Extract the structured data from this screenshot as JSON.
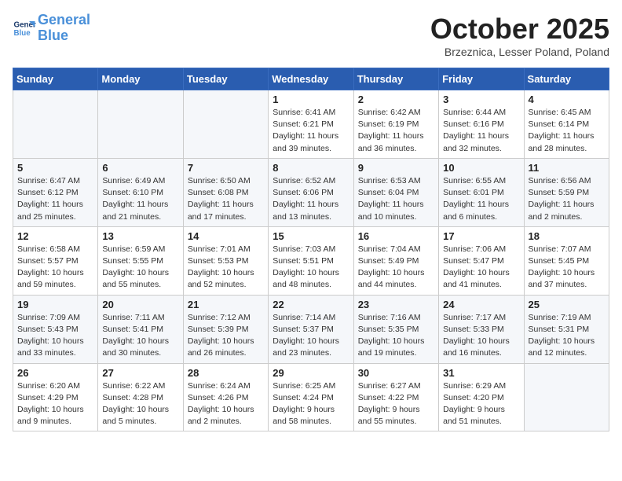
{
  "logo": {
    "line1": "General",
    "line2": "Blue"
  },
  "title": "October 2025",
  "location": "Brzeznica, Lesser Poland, Poland",
  "weekdays": [
    "Sunday",
    "Monday",
    "Tuesday",
    "Wednesday",
    "Thursday",
    "Friday",
    "Saturday"
  ],
  "weeks": [
    [
      {
        "day": "",
        "info": ""
      },
      {
        "day": "",
        "info": ""
      },
      {
        "day": "",
        "info": ""
      },
      {
        "day": "1",
        "info": "Sunrise: 6:41 AM\nSunset: 6:21 PM\nDaylight: 11 hours\nand 39 minutes."
      },
      {
        "day": "2",
        "info": "Sunrise: 6:42 AM\nSunset: 6:19 PM\nDaylight: 11 hours\nand 36 minutes."
      },
      {
        "day": "3",
        "info": "Sunrise: 6:44 AM\nSunset: 6:16 PM\nDaylight: 11 hours\nand 32 minutes."
      },
      {
        "day": "4",
        "info": "Sunrise: 6:45 AM\nSunset: 6:14 PM\nDaylight: 11 hours\nand 28 minutes."
      }
    ],
    [
      {
        "day": "5",
        "info": "Sunrise: 6:47 AM\nSunset: 6:12 PM\nDaylight: 11 hours\nand 25 minutes."
      },
      {
        "day": "6",
        "info": "Sunrise: 6:49 AM\nSunset: 6:10 PM\nDaylight: 11 hours\nand 21 minutes."
      },
      {
        "day": "7",
        "info": "Sunrise: 6:50 AM\nSunset: 6:08 PM\nDaylight: 11 hours\nand 17 minutes."
      },
      {
        "day": "8",
        "info": "Sunrise: 6:52 AM\nSunset: 6:06 PM\nDaylight: 11 hours\nand 13 minutes."
      },
      {
        "day": "9",
        "info": "Sunrise: 6:53 AM\nSunset: 6:04 PM\nDaylight: 11 hours\nand 10 minutes."
      },
      {
        "day": "10",
        "info": "Sunrise: 6:55 AM\nSunset: 6:01 PM\nDaylight: 11 hours\nand 6 minutes."
      },
      {
        "day": "11",
        "info": "Sunrise: 6:56 AM\nSunset: 5:59 PM\nDaylight: 11 hours\nand 2 minutes."
      }
    ],
    [
      {
        "day": "12",
        "info": "Sunrise: 6:58 AM\nSunset: 5:57 PM\nDaylight: 10 hours\nand 59 minutes."
      },
      {
        "day": "13",
        "info": "Sunrise: 6:59 AM\nSunset: 5:55 PM\nDaylight: 10 hours\nand 55 minutes."
      },
      {
        "day": "14",
        "info": "Sunrise: 7:01 AM\nSunset: 5:53 PM\nDaylight: 10 hours\nand 52 minutes."
      },
      {
        "day": "15",
        "info": "Sunrise: 7:03 AM\nSunset: 5:51 PM\nDaylight: 10 hours\nand 48 minutes."
      },
      {
        "day": "16",
        "info": "Sunrise: 7:04 AM\nSunset: 5:49 PM\nDaylight: 10 hours\nand 44 minutes."
      },
      {
        "day": "17",
        "info": "Sunrise: 7:06 AM\nSunset: 5:47 PM\nDaylight: 10 hours\nand 41 minutes."
      },
      {
        "day": "18",
        "info": "Sunrise: 7:07 AM\nSunset: 5:45 PM\nDaylight: 10 hours\nand 37 minutes."
      }
    ],
    [
      {
        "day": "19",
        "info": "Sunrise: 7:09 AM\nSunset: 5:43 PM\nDaylight: 10 hours\nand 33 minutes."
      },
      {
        "day": "20",
        "info": "Sunrise: 7:11 AM\nSunset: 5:41 PM\nDaylight: 10 hours\nand 30 minutes."
      },
      {
        "day": "21",
        "info": "Sunrise: 7:12 AM\nSunset: 5:39 PM\nDaylight: 10 hours\nand 26 minutes."
      },
      {
        "day": "22",
        "info": "Sunrise: 7:14 AM\nSunset: 5:37 PM\nDaylight: 10 hours\nand 23 minutes."
      },
      {
        "day": "23",
        "info": "Sunrise: 7:16 AM\nSunset: 5:35 PM\nDaylight: 10 hours\nand 19 minutes."
      },
      {
        "day": "24",
        "info": "Sunrise: 7:17 AM\nSunset: 5:33 PM\nDaylight: 10 hours\nand 16 minutes."
      },
      {
        "day": "25",
        "info": "Sunrise: 7:19 AM\nSunset: 5:31 PM\nDaylight: 10 hours\nand 12 minutes."
      }
    ],
    [
      {
        "day": "26",
        "info": "Sunrise: 6:20 AM\nSunset: 4:29 PM\nDaylight: 10 hours\nand 9 minutes."
      },
      {
        "day": "27",
        "info": "Sunrise: 6:22 AM\nSunset: 4:28 PM\nDaylight: 10 hours\nand 5 minutes."
      },
      {
        "day": "28",
        "info": "Sunrise: 6:24 AM\nSunset: 4:26 PM\nDaylight: 10 hours\nand 2 minutes."
      },
      {
        "day": "29",
        "info": "Sunrise: 6:25 AM\nSunset: 4:24 PM\nDaylight: 9 hours\nand 58 minutes."
      },
      {
        "day": "30",
        "info": "Sunrise: 6:27 AM\nSunset: 4:22 PM\nDaylight: 9 hours\nand 55 minutes."
      },
      {
        "day": "31",
        "info": "Sunrise: 6:29 AM\nSunset: 4:20 PM\nDaylight: 9 hours\nand 51 minutes."
      },
      {
        "day": "",
        "info": ""
      }
    ]
  ]
}
